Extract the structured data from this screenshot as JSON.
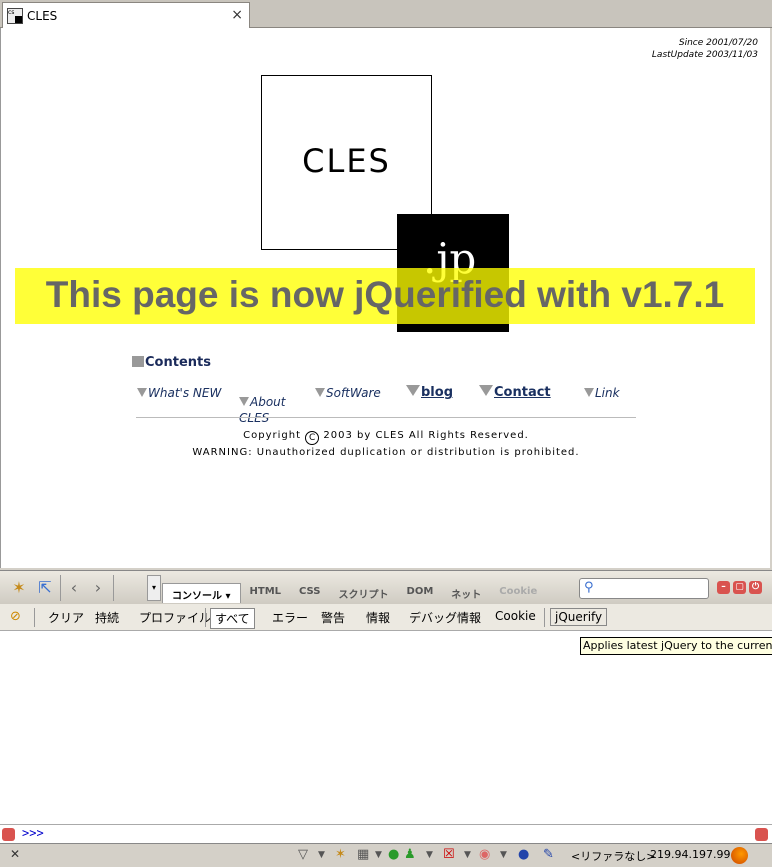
{
  "browser": {
    "tab_title": "CLES",
    "tab_favicon_text": "cs",
    "tab_close_glyph": "×"
  },
  "page": {
    "since": "Since 2001/07/20",
    "last_update": "LastUpdate 2003/11/03",
    "logo_main": "CLES",
    "logo_sub": ".jp",
    "banner": "This page is now jQuerified with v1.7.1",
    "banner_color": "#ffff00",
    "contents_heading": "Contents",
    "nav": [
      {
        "label": "What's NEW"
      },
      {
        "label": "About\nCLES"
      },
      {
        "label": "SoftWare"
      },
      {
        "label": "blog"
      },
      {
        "label": "Contact"
      },
      {
        "label": "Link"
      }
    ],
    "copyright_pre": "Copyright",
    "copyright_symbol": "C",
    "copyright_post": "2003 by CLES All Rights Reserved.",
    "warning": "WARNING: Unauthorized duplication or distribution is prohibited."
  },
  "firebug": {
    "tabs": [
      "コンソール ▾",
      "HTML",
      "CSS",
      "スクリプト",
      "DOM",
      "ネット",
      "Cookie"
    ],
    "active_tab": 0,
    "console_buttons": [
      "クリア",
      "持続",
      "プロファイル",
      "すべて",
      "エラー",
      "警告",
      "情報",
      "デバッグ情報",
      "Cookie",
      "jQuerify"
    ],
    "tooltip": "Applies latest jQuery to the current page",
    "prompt": ">>>",
    "icons": {
      "inspect": "bug-icon",
      "pointer": "inspect-pointer-icon",
      "back": "chevron-left-icon",
      "forward": "chevron-right-icon",
      "search": "search-icon"
    }
  },
  "statusbar": {
    "close_glyph": "✕",
    "text": "<リファラなし>",
    "ip": "219.94.197.99"
  }
}
